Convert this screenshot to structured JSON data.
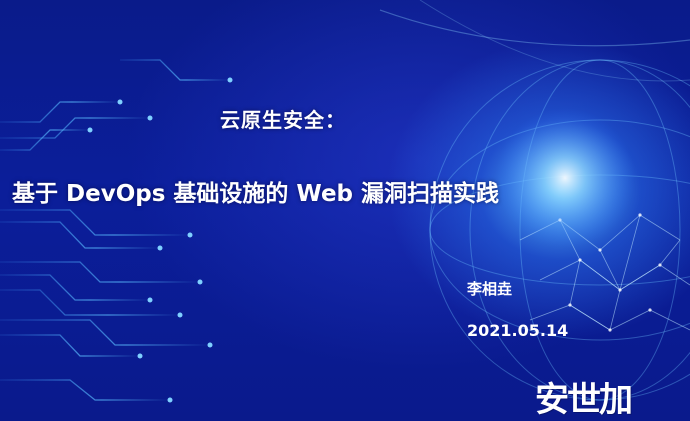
{
  "slide": {
    "title_line1": "云原生安全：",
    "title_line2": "基于 DevOps 基础设施的 Web 漏洞扫描实践",
    "author": "李相垚",
    "date": "2021.05.14",
    "logo_text": "安世加"
  },
  "colors": {
    "background": "#0b1e9a",
    "glow": "#5abeff",
    "text": "#ffffff"
  }
}
